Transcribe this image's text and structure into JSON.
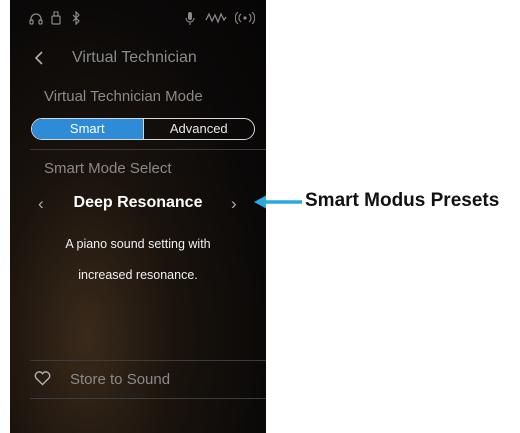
{
  "screen": {
    "title": "Virtual Technician",
    "mode_section_label": "Virtual Technician Mode",
    "mode_options": {
      "smart": "Smart",
      "advanced": "Advanced"
    },
    "selected_mode": "Smart",
    "select_section_label": "Smart Mode Select",
    "preset_name": "Deep Resonance",
    "description_line1": "A piano sound setting with",
    "description_line2": "increased resonance.",
    "store_label": "Store to Sound"
  },
  "status_icons": [
    "headphones-icon",
    "usb-icon",
    "bluetooth-icon",
    "microphone-icon",
    "recorder-icon",
    "wireless-icon"
  ],
  "callout": {
    "label": "Smart Modus Presets",
    "color": "#2aa8df"
  },
  "colors": {
    "accent": "#2d8bd8",
    "text_dim": "#8a8a8a",
    "text_bright": "#ffffff"
  }
}
